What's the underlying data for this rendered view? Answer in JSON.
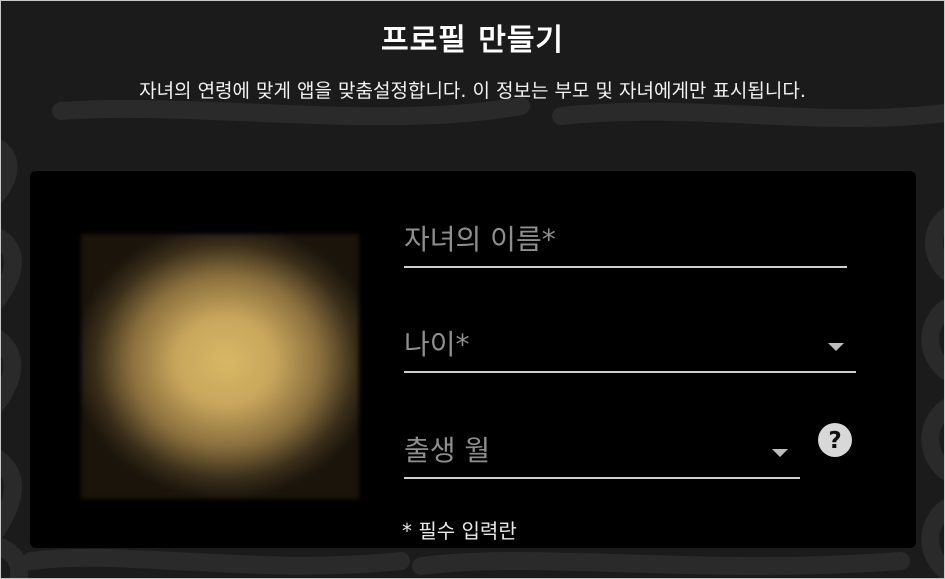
{
  "page": {
    "title": "프로필 만들기",
    "subtitle": "자녀의 연령에 맞게 앱을 맞춤설정합니다. 이 정보는 부모 및 자녀에게만 표시됩니다."
  },
  "form": {
    "name_label": "자녀의 이름*",
    "age_label": "나이*",
    "birth_month_label": "출생 월",
    "help_icon": "question-circle-icon",
    "required_note": "* 필수 입력란"
  },
  "colors": {
    "background": "#1b1b1b",
    "card": "#000000",
    "label": "#8f8f8f",
    "underline": "#cfcfcf"
  }
}
